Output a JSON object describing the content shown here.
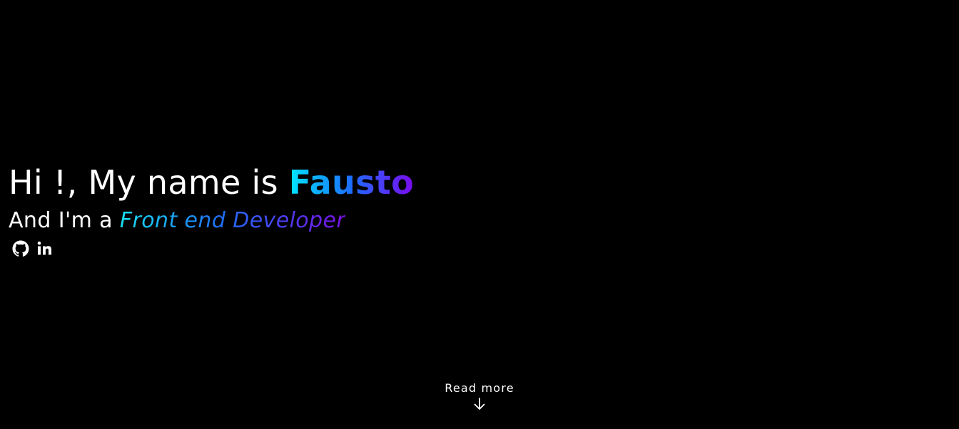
{
  "hero": {
    "greeting": "Hi !, My name is ",
    "name": "Fausto",
    "intro": "And I'm a ",
    "role": "Front end Developer"
  },
  "socials": [
    {
      "icon": "github-icon"
    },
    {
      "icon": "linkedin-icon"
    }
  ],
  "read_more": {
    "label": "Read more",
    "icon": "arrow-down-icon"
  },
  "colors": {
    "background": "#000000",
    "text": "#ffffff",
    "gradient_start": "#00e5ff",
    "gradient_mid": "#1d6dff",
    "gradient_end": "#7a0bf0"
  }
}
